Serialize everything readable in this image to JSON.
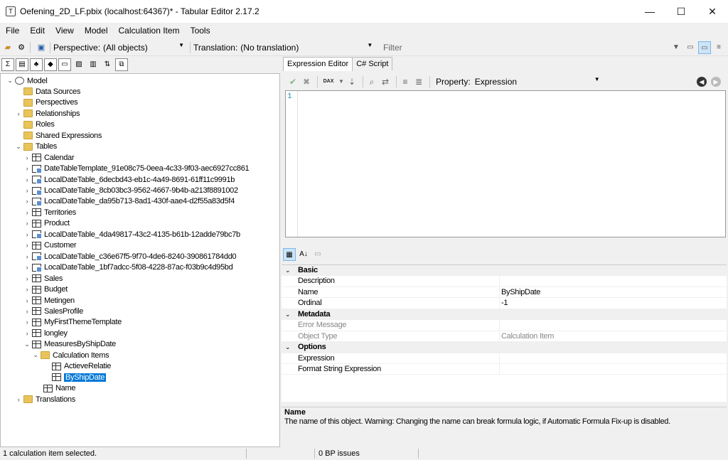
{
  "window": {
    "title": "Oefening_2D_LF.pbix (localhost:64367)* - Tabular Editor 2.17.2",
    "minimize": "—",
    "maximize": "☐",
    "close": "✕"
  },
  "menu": [
    "File",
    "Edit",
    "View",
    "Model",
    "Calculation Item",
    "Tools"
  ],
  "toolbar": {
    "perspective_label": "Perspective:",
    "perspective_value": "(All objects)",
    "translation_label": "Translation:",
    "translation_value": "(No translation)",
    "filter_placeholder": "Filter"
  },
  "tree": {
    "model": "Model",
    "items": [
      {
        "label": "Data Sources"
      },
      {
        "label": "Perspectives"
      },
      {
        "label": "Relationships"
      },
      {
        "label": "Roles"
      },
      {
        "label": "Shared Expressions"
      },
      {
        "label": "Tables"
      }
    ],
    "tables": [
      "Calendar",
      "DateTableTemplate_91e08c75-0eea-4c33-9f03-aec6927cc861",
      "LocalDateTable_6decbd43-eb1c-4a49-8691-61ff11c9991b",
      "LocalDateTable_8cb03bc3-9562-4667-9b4b-a213f8891002",
      "LocalDateTable_da95b713-8ad1-430f-aae4-d2f55a83d5f4",
      "Territories",
      "Product",
      "LocalDateTable_4da49817-43c2-4135-b61b-12adde79bc7b",
      "Customer",
      "LocalDateTable_c36e67f5-9f70-4de6-8240-390861784dd0",
      "LocalDateTable_1bf7adcc-5f08-4228-87ac-f03b9c4d95bd",
      "Sales",
      "Budget",
      "Metingen",
      "SalesProfile",
      "MyFirstThemeTemplate",
      "longley",
      "MeasuresByShipDate"
    ],
    "calc_items_folder": "Calculation Items",
    "calc_items": [
      "ActieveRelatie",
      "ByShipDate"
    ],
    "name_column": "Name",
    "translations": "Translations"
  },
  "editor": {
    "tabs": [
      "Expression Editor",
      "C# Script"
    ],
    "property_label": "Property:",
    "property_value": "Expression",
    "line_number": "1",
    "dax_label": "DAX"
  },
  "properties": {
    "categories": [
      {
        "name": "Basic",
        "rows": [
          {
            "name": "Description",
            "value": ""
          },
          {
            "name": "Name",
            "value": "ByShipDate"
          },
          {
            "name": "Ordinal",
            "value": "-1"
          }
        ]
      },
      {
        "name": "Metadata",
        "rows": [
          {
            "name": "Error Message",
            "value": ""
          },
          {
            "name": "Object Type",
            "value": "Calculation Item"
          }
        ]
      },
      {
        "name": "Options",
        "rows": [
          {
            "name": "Expression",
            "value": ""
          },
          {
            "name": "Format String Expression",
            "value": ""
          }
        ]
      }
    ]
  },
  "help": {
    "title": "Name",
    "text": "The name of this object. Warning: Changing the name can break formula logic, if Automatic Formula Fix-up is disabled."
  },
  "status": {
    "selection": "1 calculation item selected.",
    "bp_issues": "0 BP issues"
  },
  "colors": {
    "selection": "#0078d7",
    "folder": "#e8c45a"
  }
}
